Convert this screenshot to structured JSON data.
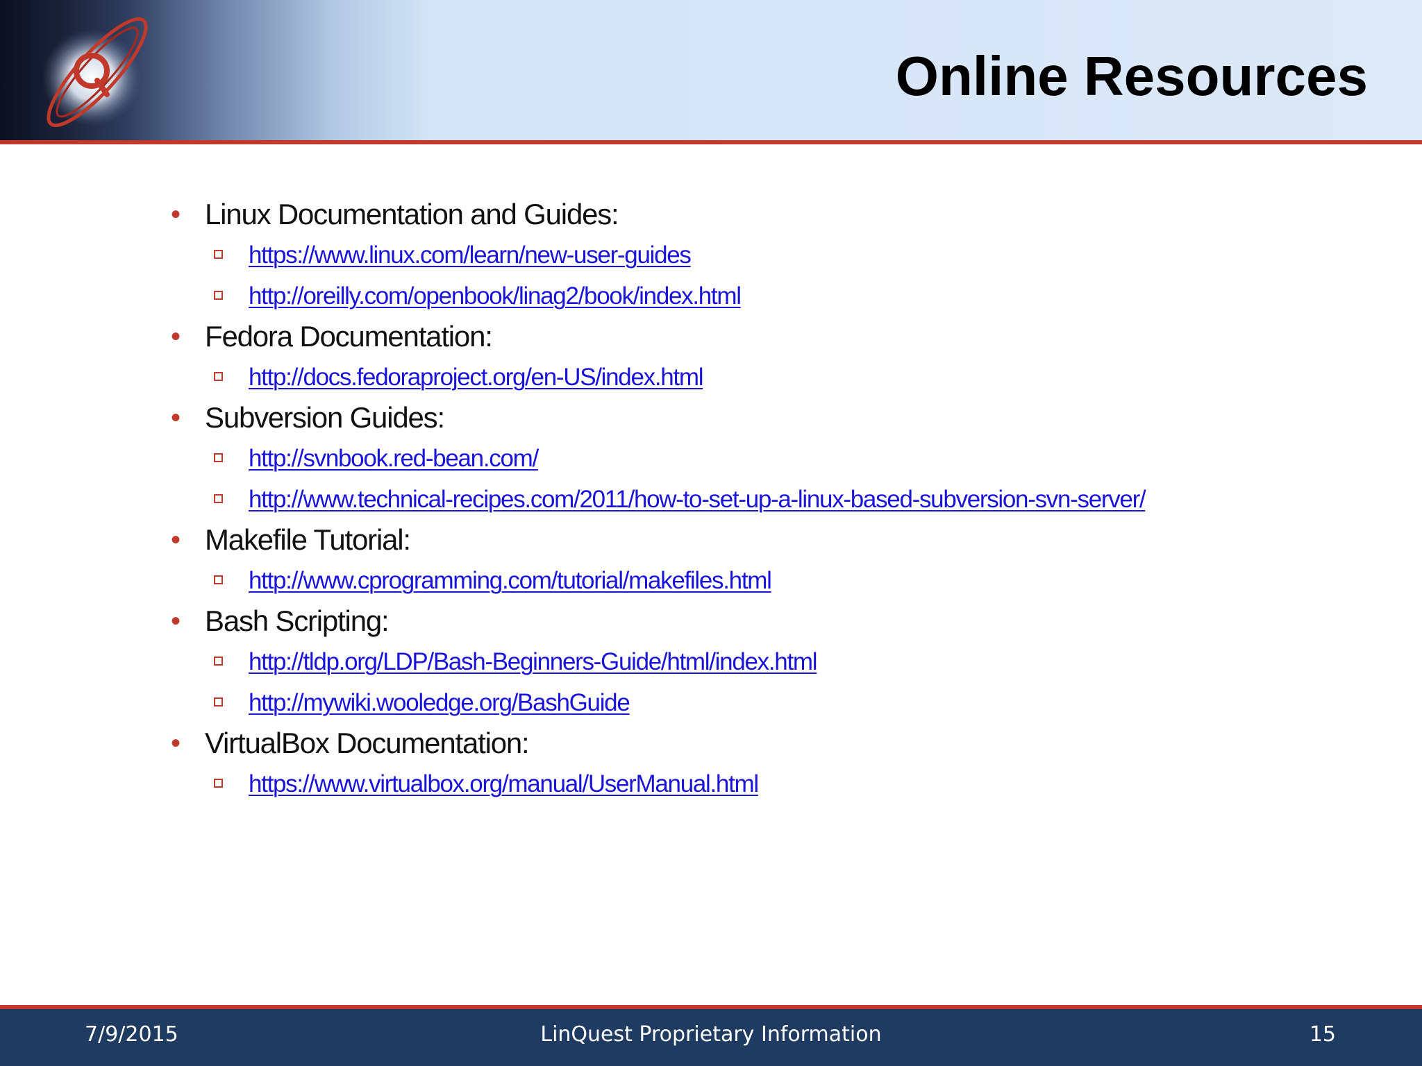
{
  "slide": {
    "title": "Online Resources",
    "sections": [
      {
        "heading": "Linux Documentation and Guides:",
        "links": [
          "https://www.linux.com/learn/new-user-guides",
          "http://oreilly.com/openbook/linag2/book/index.html"
        ]
      },
      {
        "heading": "Fedora Documentation:",
        "links": [
          "http://docs.fedoraproject.org/en-US/index.html"
        ]
      },
      {
        "heading": "Subversion Guides:",
        "links": [
          "http://svnbook.red-bean.com/",
          "http://www.technical-recipes.com/2011/how-to-set-up-a-linux-based-subversion-svn-server/"
        ]
      },
      {
        "heading": "Makefile Tutorial:",
        "links": [
          "http://www.cprogramming.com/tutorial/makefiles.html"
        ]
      },
      {
        "heading": "Bash Scripting:",
        "links": [
          "http://tldp.org/LDP/Bash-Beginners-Guide/html/index.html",
          "http://mywiki.wooledge.org/BashGuide"
        ]
      },
      {
        "heading": "VirtualBox Documentation:",
        "links": [
          "https://www.virtualbox.org/manual/UserManual.html"
        ]
      }
    ]
  },
  "footer": {
    "date": "7/9/2015",
    "center": "LinQuest Proprietary Information",
    "page": "15"
  },
  "colors": {
    "accent_red": "#c0392b",
    "footer_navy": "#1f3b61",
    "link_blue": "#1a14d8"
  },
  "icons": {
    "logo": "linquest-q-logo-icon",
    "bullet": "round-bullet-icon",
    "sub_bullet": "hollow-square-bullet-icon"
  }
}
